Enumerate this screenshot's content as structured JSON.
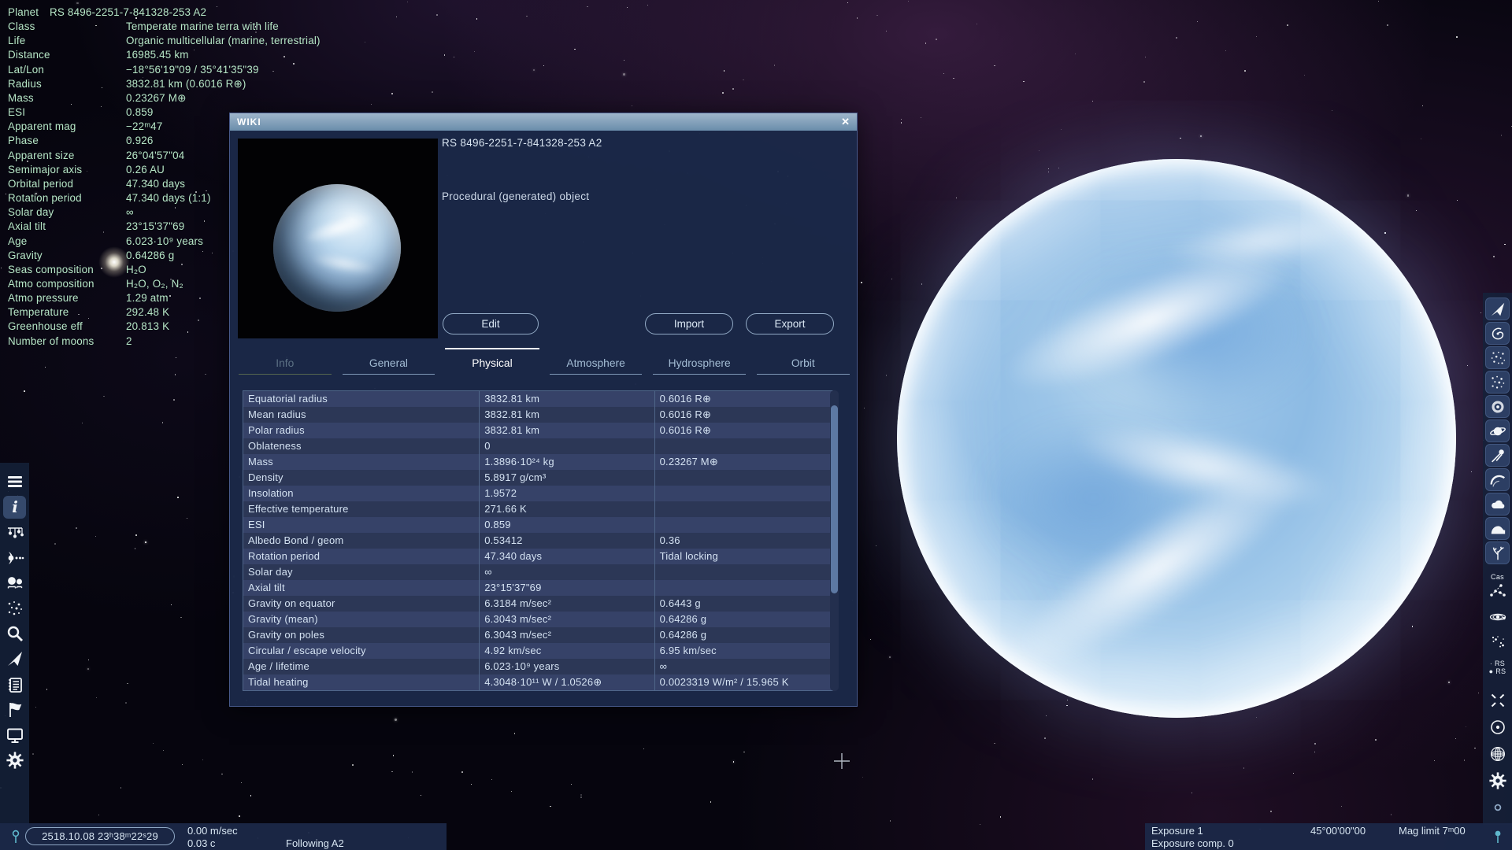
{
  "info_panel": {
    "rows": [
      {
        "label": "Planet",
        "value": "RS 8496-2251-7-841328-253 A2"
      },
      {
        "label": "Class",
        "value": "Temperate marine terra with life"
      },
      {
        "label": "Life",
        "value": "Organic multicellular (marine, terrestrial)"
      },
      {
        "label": "Distance",
        "value": "16985.45 km"
      },
      {
        "label": "Lat/Lon",
        "value": "−18°56'19\"09 / 35°41'35\"39"
      },
      {
        "label": "Radius",
        "value": "3832.81 km (0.6016 R⊕)"
      },
      {
        "label": "Mass",
        "value": "0.23267 M⊕"
      },
      {
        "label": "ESI",
        "value": "0.859"
      },
      {
        "label": "Apparent mag",
        "value": "−22ᵐ47"
      },
      {
        "label": "Phase",
        "value": "0.926"
      },
      {
        "label": "Apparent size",
        "value": "26°04'57\"04"
      },
      {
        "label": "Semimajor axis",
        "value": "0.26 AU"
      },
      {
        "label": "Orbital period",
        "value": "47.340 days"
      },
      {
        "label": "Rotation period",
        "value": "47.340 days (1:1)"
      },
      {
        "label": "Solar day",
        "value": "∞"
      },
      {
        "label": "Axial tilt",
        "value": "23°15'37\"69"
      },
      {
        "label": "Age",
        "value": "6.023·10⁹ years"
      },
      {
        "label": "Gravity",
        "value": "0.64286 g"
      },
      {
        "label": "Seas composition",
        "value": "H₂O"
      },
      {
        "label": "Atmo composition",
        "value": "H₂O, O₂, N₂"
      },
      {
        "label": "Atmo pressure",
        "value": "1.29 atm"
      },
      {
        "label": "Temperature",
        "value": "292.48 K"
      },
      {
        "label": "Greenhouse eff",
        "value": "20.813 K"
      },
      {
        "label": "Number of moons",
        "value": "2"
      }
    ]
  },
  "wiki": {
    "title": "WIKI",
    "close_glyph": "✕",
    "object_name": "RS 8496-2251-7-841328-253 A2",
    "object_type": "Procedural (generated) object",
    "buttons": {
      "edit": "Edit",
      "import": "Import",
      "export": "Export"
    },
    "tabs": [
      {
        "label": "Info",
        "state": "disabled"
      },
      {
        "label": "General",
        "state": "normal"
      },
      {
        "label": "Physical",
        "state": "active"
      },
      {
        "label": "Atmosphere",
        "state": "normal"
      },
      {
        "label": "Hydrosphere",
        "state": "normal"
      },
      {
        "label": "Orbit",
        "state": "normal"
      }
    ],
    "table": {
      "rows": [
        [
          "Equatorial radius",
          "3832.81 km",
          "0.6016 R⊕"
        ],
        [
          "Mean radius",
          "3832.81 km",
          "0.6016 R⊕"
        ],
        [
          "Polar radius",
          "3832.81 km",
          "0.6016 R⊕"
        ],
        [
          "Oblateness",
          "0",
          ""
        ],
        [
          "Mass",
          "1.3896·10²⁴ kg",
          "0.23267 M⊕"
        ],
        [
          "Density",
          "5.8917 g/cm³",
          ""
        ],
        [
          "Insolation",
          "1.9572",
          ""
        ],
        [
          "Effective temperature",
          "271.66 K",
          ""
        ],
        [
          "ESI",
          "0.859",
          ""
        ],
        [
          "Albedo Bond / geom",
          "0.53412",
          "0.36"
        ],
        [
          "Rotation period",
          "47.340 days",
          "Tidal locking"
        ],
        [
          "Solar day",
          "∞",
          ""
        ],
        [
          "Axial tilt",
          "23°15'37\"69",
          ""
        ],
        [
          "Gravity on equator",
          "6.3184 m/sec²",
          "0.6443 g"
        ],
        [
          "Gravity (mean)",
          "6.3043 m/sec²",
          "0.64286 g"
        ],
        [
          "Gravity on poles",
          "6.3043 m/sec²",
          "0.64286 g"
        ],
        [
          "Circular / escape velocity",
          "4.92 km/sec",
          "6.95 km/sec"
        ],
        [
          "Age / lifetime",
          "6.023·10⁹ years",
          "∞"
        ],
        [
          "Tidal heating",
          "4.3048·10¹¹ W / 1.0526⊕",
          "0.0023319 W/m² / 15.965 K"
        ]
      ]
    }
  },
  "left_toolbar": {
    "items": [
      {
        "name": "menu-button",
        "icon": "menu",
        "active": false
      },
      {
        "name": "info-panel-button",
        "icon": "info",
        "active": true
      },
      {
        "name": "system-chart-button",
        "icon": "orrery",
        "active": false
      },
      {
        "name": "planet-browser-button",
        "icon": "planet-system",
        "active": false
      },
      {
        "name": "star-browser-button",
        "icon": "binary-star",
        "active": false
      },
      {
        "name": "cluster-browser-button",
        "icon": "star-cluster",
        "active": false
      },
      {
        "name": "search-button",
        "icon": "search",
        "active": false
      },
      {
        "name": "flight-mode-button",
        "icon": "spaceship",
        "active": false
      },
      {
        "name": "journal-button",
        "icon": "journal",
        "active": false
      },
      {
        "name": "flags-button",
        "icon": "flag",
        "active": false
      },
      {
        "name": "display-settings-button",
        "icon": "display",
        "active": false
      },
      {
        "name": "settings-button",
        "icon": "gear",
        "active": false
      }
    ]
  },
  "right_toolbar": {
    "buttons": [
      {
        "name": "toggle-spacecraft",
        "icon": "spaceship"
      },
      {
        "name": "toggle-galaxies",
        "icon": "galaxy"
      },
      {
        "name": "toggle-stars",
        "icon": "stars"
      },
      {
        "name": "toggle-clusters",
        "icon": "star-cluster"
      },
      {
        "name": "toggle-nebulae",
        "icon": "nebula"
      },
      {
        "name": "toggle-planets",
        "icon": "ringed-planet"
      },
      {
        "name": "toggle-comets",
        "icon": "comet"
      },
      {
        "name": "toggle-atmospheres",
        "icon": "aurora"
      },
      {
        "name": "toggle-clouds",
        "icon": "clouds"
      },
      {
        "name": "toggle-water",
        "icon": "water"
      },
      {
        "name": "toggle-life",
        "icon": "life"
      }
    ],
    "plain": [
      {
        "name": "toggle-constellations",
        "icon": "constellation",
        "label": "Cas"
      },
      {
        "name": "toggle-orbits",
        "icon": "orbits"
      },
      {
        "name": "toggle-star-markers",
        "icon": "star-sprites"
      },
      {
        "name": "toggle-object-labels",
        "icon": "rs-labels",
        "lines": [
          "· RS",
          "● RS"
        ]
      },
      {
        "name": "selection-marker-toggle",
        "icon": "selection-marker"
      },
      {
        "name": "toggle-orbit-markers",
        "icon": "circle-dot"
      },
      {
        "name": "toggle-grid",
        "icon": "globe-grid"
      },
      {
        "name": "view-settings-button",
        "icon": "gear"
      },
      {
        "name": "indicator-dot",
        "icon": "small-dot"
      }
    ]
  },
  "status_left": {
    "time": "2518.10.08 23ʰ38ᵐ22ˢ29",
    "speed": "0.00 m/sec",
    "speed_c": "0.03 c",
    "following": "Following A2"
  },
  "status_right": {
    "exposure": "Exposure 1",
    "exposure_comp": "Exposure comp. 0",
    "fov": "45°00'00\"00",
    "mag_limit": "Mag limit 7ᵐ00"
  },
  "colors": {
    "info_text": "#b6e6c6",
    "dialog_bg": "#1b2848",
    "titlebar": "#7b9cb8",
    "accent_border": "#8fa8c5",
    "table_row_light": "#364268",
    "table_row_dark": "#2c3756",
    "pin_icon": "#5fb7cc"
  }
}
